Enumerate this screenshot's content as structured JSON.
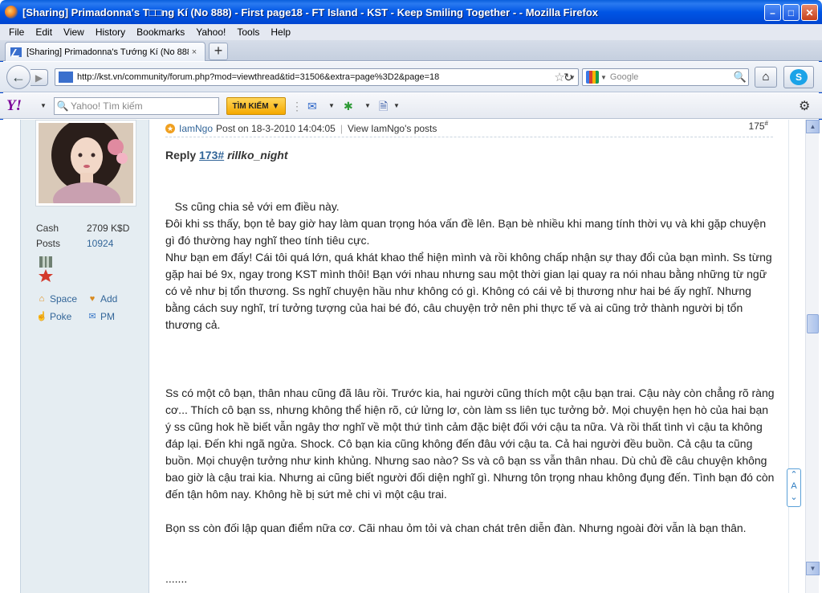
{
  "window": {
    "title": "[Sharing] Primadonna's T□□ng Kí (No 888) - First page18 - FT Island - KST - Keep Smiling Together - - Mozilla Firefox",
    "min": "–",
    "max": "□",
    "close": "✕"
  },
  "menu": [
    "File",
    "Edit",
    "View",
    "History",
    "Bookmarks",
    "Yahoo!",
    "Tools",
    "Help"
  ],
  "tab": {
    "label": "[Sharing] Primadonna's Tướng Kí (No 888) - ...",
    "close": "×",
    "new": "+"
  },
  "nav": {
    "url": "http://kst.vn/community/forum.php?mod=viewthread&tid=31506&extra=page%3D2&page=18",
    "search_placeholder": "Google"
  },
  "yahoo": {
    "logo": "Y!",
    "search_placeholder": "Yahoo! Tìm kiếm",
    "search_button": "TÌM KIẾM"
  },
  "sidebar": {
    "stats": [
      {
        "label": "Cash",
        "value": "2709 K$D"
      },
      {
        "label": "Posts",
        "value": "10924"
      }
    ],
    "links": [
      {
        "label": "Space",
        "icon": "home-icon"
      },
      {
        "label": "Add",
        "icon": "add-friend-icon"
      },
      {
        "label": "Poke",
        "icon": "poke-icon"
      },
      {
        "label": "PM",
        "icon": "mail-icon"
      }
    ]
  },
  "post": {
    "author": "IamNgo",
    "posted": "Post on 18-3-2010 14:04:05",
    "view_posts": "View IamNgo's posts",
    "number": "175",
    "number_sup": "#",
    "reply_prefix": "Reply",
    "reply_link": "173#",
    "reply_user": "rillko_night",
    "paragraphs": [
      "   Ss cũng chia sẻ với em điều này.\nĐôi khi ss thấy, bọn tẻ bay giờ hay làm quan trọng hóa vấn đề lên. Bạn bè nhiều khi mang tính thời vụ và khi gặp chuyện gì đó thường hay nghĩ theo tính tiêu cực.\nNhư bạn em đấy! Cái tôi quá lớn, quá khát khao thể hiện mình và rồi không chấp nhận sự thay đổi của bạn mình. Ss từng gặp hai bé 9x, ngay trong KST mình thôi! Bạn với nhau nhưng sau một thời gian lại quay ra nói nhau bằng những từ ngữ có vẻ như bị tổn thương. Ss nghĩ chuyện hầu như không có gì. Không có cái vẻ bị thương như hai bé ấy nghĩ. Nhưng bằng cách suy nghĩ, trí tưởng tượng của hai bé đó, câu chuyện trở nên phi thực tế và ai cũng trở thành người bị tổn thương cả.",
      "Ss có một cô bạn, thân nhau cũng đã lâu rồi. Trước kia, hai người cũng thích một cậu bạn trai. Cậu này còn chẳng rõ ràng cơ... Thích cô bạn ss, nhưng không thể hiện rõ, cứ lửng lơ, còn làm ss  liên tục tưởng bở. Mọi chuyện hẹn hò của hai bạn ý ss cũng hok hề biết vẫn ngây thơ nghĩ về một thứ tình cảm đặc biệt đối với cậu ta nữa. Và rồi thất tình vì cậu ta không đáp lại. Đến khi ngã ngửa. Shock. Cô bạn kia cũng không đến đâu với cậu ta. Cả hai người đều buồn. Cả cậu ta cũng buồn. Mọi chuyện tưởng như kinh khủng. Nhưng sao nào? Ss và cô bạn ss vẫn thân nhau. Dù chủ đề câu chuyện không bao giờ là cậu trai kia. Nhưng ai cũng biết người đối diện nghĩ gì. Nhưng tôn trọng nhau không đụng đến. Tình bạn đó còn đến tận hôm nay. Không hề bị sứt mẻ chi vì một cậu trai.",
      "Bọn ss còn đối lập quan điểm nữa cơ. Cãi nhau ỏm tỏi và chan chát trên diễn đàn. Nhưng ngoài đời vẫn là bạn thân.",
      "......."
    ]
  }
}
